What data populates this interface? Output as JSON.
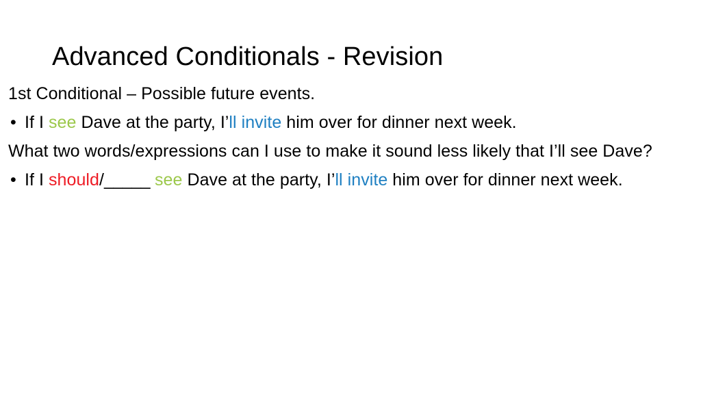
{
  "slide": {
    "title": "Advanced Conditionals - Revision",
    "background_color": "#FFFFFF",
    "text_color": "#000000",
    "accent_colors": {
      "green": "#9CC84B",
      "blue": "#2080C2",
      "red": "#EE1C25"
    },
    "bullet_glyph": "•",
    "lines": {
      "heading_line": "1st Conditional – Possible future events.",
      "example_1": {
        "part_1": "If I ",
        "verb_if": "see",
        "part_2": " Dave at the party, I’",
        "verb_result": "ll invite",
        "part_3": " him over for dinner next week."
      },
      "question": "What two words/expressions can I use to make it sound less likely that I’ll see Dave?",
      "example_2": {
        "part_1": "If I ",
        "modal": "should",
        "slash": "/",
        "blank": "_____",
        "space": " ",
        "verb_if": "see",
        "part_2": " Dave at the party, I’",
        "verb_result": "ll invite",
        "part_3": " him over for dinner next week."
      }
    }
  }
}
